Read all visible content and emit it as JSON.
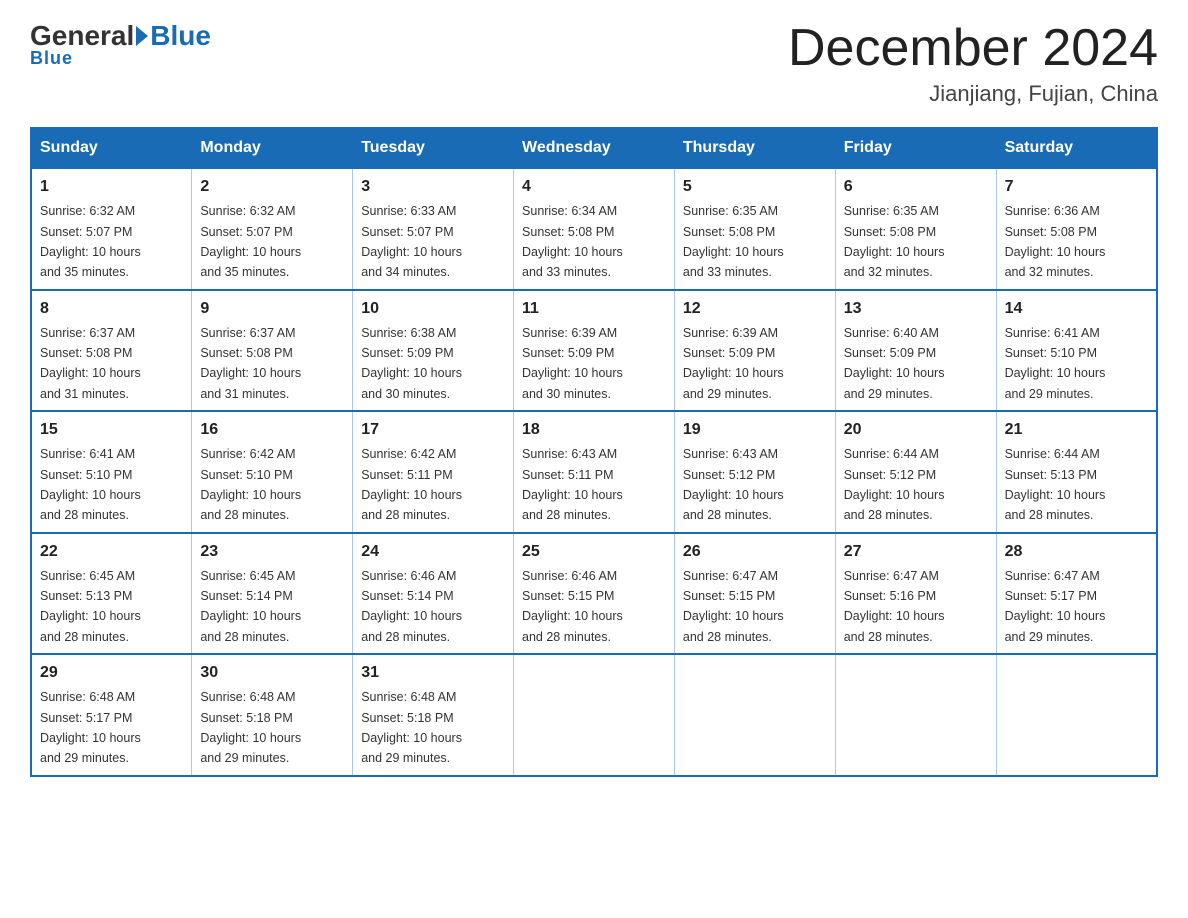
{
  "header": {
    "logo_general": "General",
    "logo_blue": "Blue",
    "month_title": "December 2024",
    "location": "Jianjiang, Fujian, China"
  },
  "weekdays": [
    "Sunday",
    "Monday",
    "Tuesday",
    "Wednesday",
    "Thursday",
    "Friday",
    "Saturday"
  ],
  "weeks": [
    [
      {
        "day": "1",
        "sunrise": "6:32 AM",
        "sunset": "5:07 PM",
        "daylight": "10 hours and 35 minutes."
      },
      {
        "day": "2",
        "sunrise": "6:32 AM",
        "sunset": "5:07 PM",
        "daylight": "10 hours and 35 minutes."
      },
      {
        "day": "3",
        "sunrise": "6:33 AM",
        "sunset": "5:07 PM",
        "daylight": "10 hours and 34 minutes."
      },
      {
        "day": "4",
        "sunrise": "6:34 AM",
        "sunset": "5:08 PM",
        "daylight": "10 hours and 33 minutes."
      },
      {
        "day": "5",
        "sunrise": "6:35 AM",
        "sunset": "5:08 PM",
        "daylight": "10 hours and 33 minutes."
      },
      {
        "day": "6",
        "sunrise": "6:35 AM",
        "sunset": "5:08 PM",
        "daylight": "10 hours and 32 minutes."
      },
      {
        "day": "7",
        "sunrise": "6:36 AM",
        "sunset": "5:08 PM",
        "daylight": "10 hours and 32 minutes."
      }
    ],
    [
      {
        "day": "8",
        "sunrise": "6:37 AM",
        "sunset": "5:08 PM",
        "daylight": "10 hours and 31 minutes."
      },
      {
        "day": "9",
        "sunrise": "6:37 AM",
        "sunset": "5:08 PM",
        "daylight": "10 hours and 31 minutes."
      },
      {
        "day": "10",
        "sunrise": "6:38 AM",
        "sunset": "5:09 PM",
        "daylight": "10 hours and 30 minutes."
      },
      {
        "day": "11",
        "sunrise": "6:39 AM",
        "sunset": "5:09 PM",
        "daylight": "10 hours and 30 minutes."
      },
      {
        "day": "12",
        "sunrise": "6:39 AM",
        "sunset": "5:09 PM",
        "daylight": "10 hours and 29 minutes."
      },
      {
        "day": "13",
        "sunrise": "6:40 AM",
        "sunset": "5:09 PM",
        "daylight": "10 hours and 29 minutes."
      },
      {
        "day": "14",
        "sunrise": "6:41 AM",
        "sunset": "5:10 PM",
        "daylight": "10 hours and 29 minutes."
      }
    ],
    [
      {
        "day": "15",
        "sunrise": "6:41 AM",
        "sunset": "5:10 PM",
        "daylight": "10 hours and 28 minutes."
      },
      {
        "day": "16",
        "sunrise": "6:42 AM",
        "sunset": "5:10 PM",
        "daylight": "10 hours and 28 minutes."
      },
      {
        "day": "17",
        "sunrise": "6:42 AM",
        "sunset": "5:11 PM",
        "daylight": "10 hours and 28 minutes."
      },
      {
        "day": "18",
        "sunrise": "6:43 AM",
        "sunset": "5:11 PM",
        "daylight": "10 hours and 28 minutes."
      },
      {
        "day": "19",
        "sunrise": "6:43 AM",
        "sunset": "5:12 PM",
        "daylight": "10 hours and 28 minutes."
      },
      {
        "day": "20",
        "sunrise": "6:44 AM",
        "sunset": "5:12 PM",
        "daylight": "10 hours and 28 minutes."
      },
      {
        "day": "21",
        "sunrise": "6:44 AM",
        "sunset": "5:13 PM",
        "daylight": "10 hours and 28 minutes."
      }
    ],
    [
      {
        "day": "22",
        "sunrise": "6:45 AM",
        "sunset": "5:13 PM",
        "daylight": "10 hours and 28 minutes."
      },
      {
        "day": "23",
        "sunrise": "6:45 AM",
        "sunset": "5:14 PM",
        "daylight": "10 hours and 28 minutes."
      },
      {
        "day": "24",
        "sunrise": "6:46 AM",
        "sunset": "5:14 PM",
        "daylight": "10 hours and 28 minutes."
      },
      {
        "day": "25",
        "sunrise": "6:46 AM",
        "sunset": "5:15 PM",
        "daylight": "10 hours and 28 minutes."
      },
      {
        "day": "26",
        "sunrise": "6:47 AM",
        "sunset": "5:15 PM",
        "daylight": "10 hours and 28 minutes."
      },
      {
        "day": "27",
        "sunrise": "6:47 AM",
        "sunset": "5:16 PM",
        "daylight": "10 hours and 28 minutes."
      },
      {
        "day": "28",
        "sunrise": "6:47 AM",
        "sunset": "5:17 PM",
        "daylight": "10 hours and 29 minutes."
      }
    ],
    [
      {
        "day": "29",
        "sunrise": "6:48 AM",
        "sunset": "5:17 PM",
        "daylight": "10 hours and 29 minutes."
      },
      {
        "day": "30",
        "sunrise": "6:48 AM",
        "sunset": "5:18 PM",
        "daylight": "10 hours and 29 minutes."
      },
      {
        "day": "31",
        "sunrise": "6:48 AM",
        "sunset": "5:18 PM",
        "daylight": "10 hours and 29 minutes."
      },
      null,
      null,
      null,
      null
    ]
  ],
  "labels": {
    "sunrise": "Sunrise:",
    "sunset": "Sunset:",
    "daylight": "Daylight:"
  }
}
